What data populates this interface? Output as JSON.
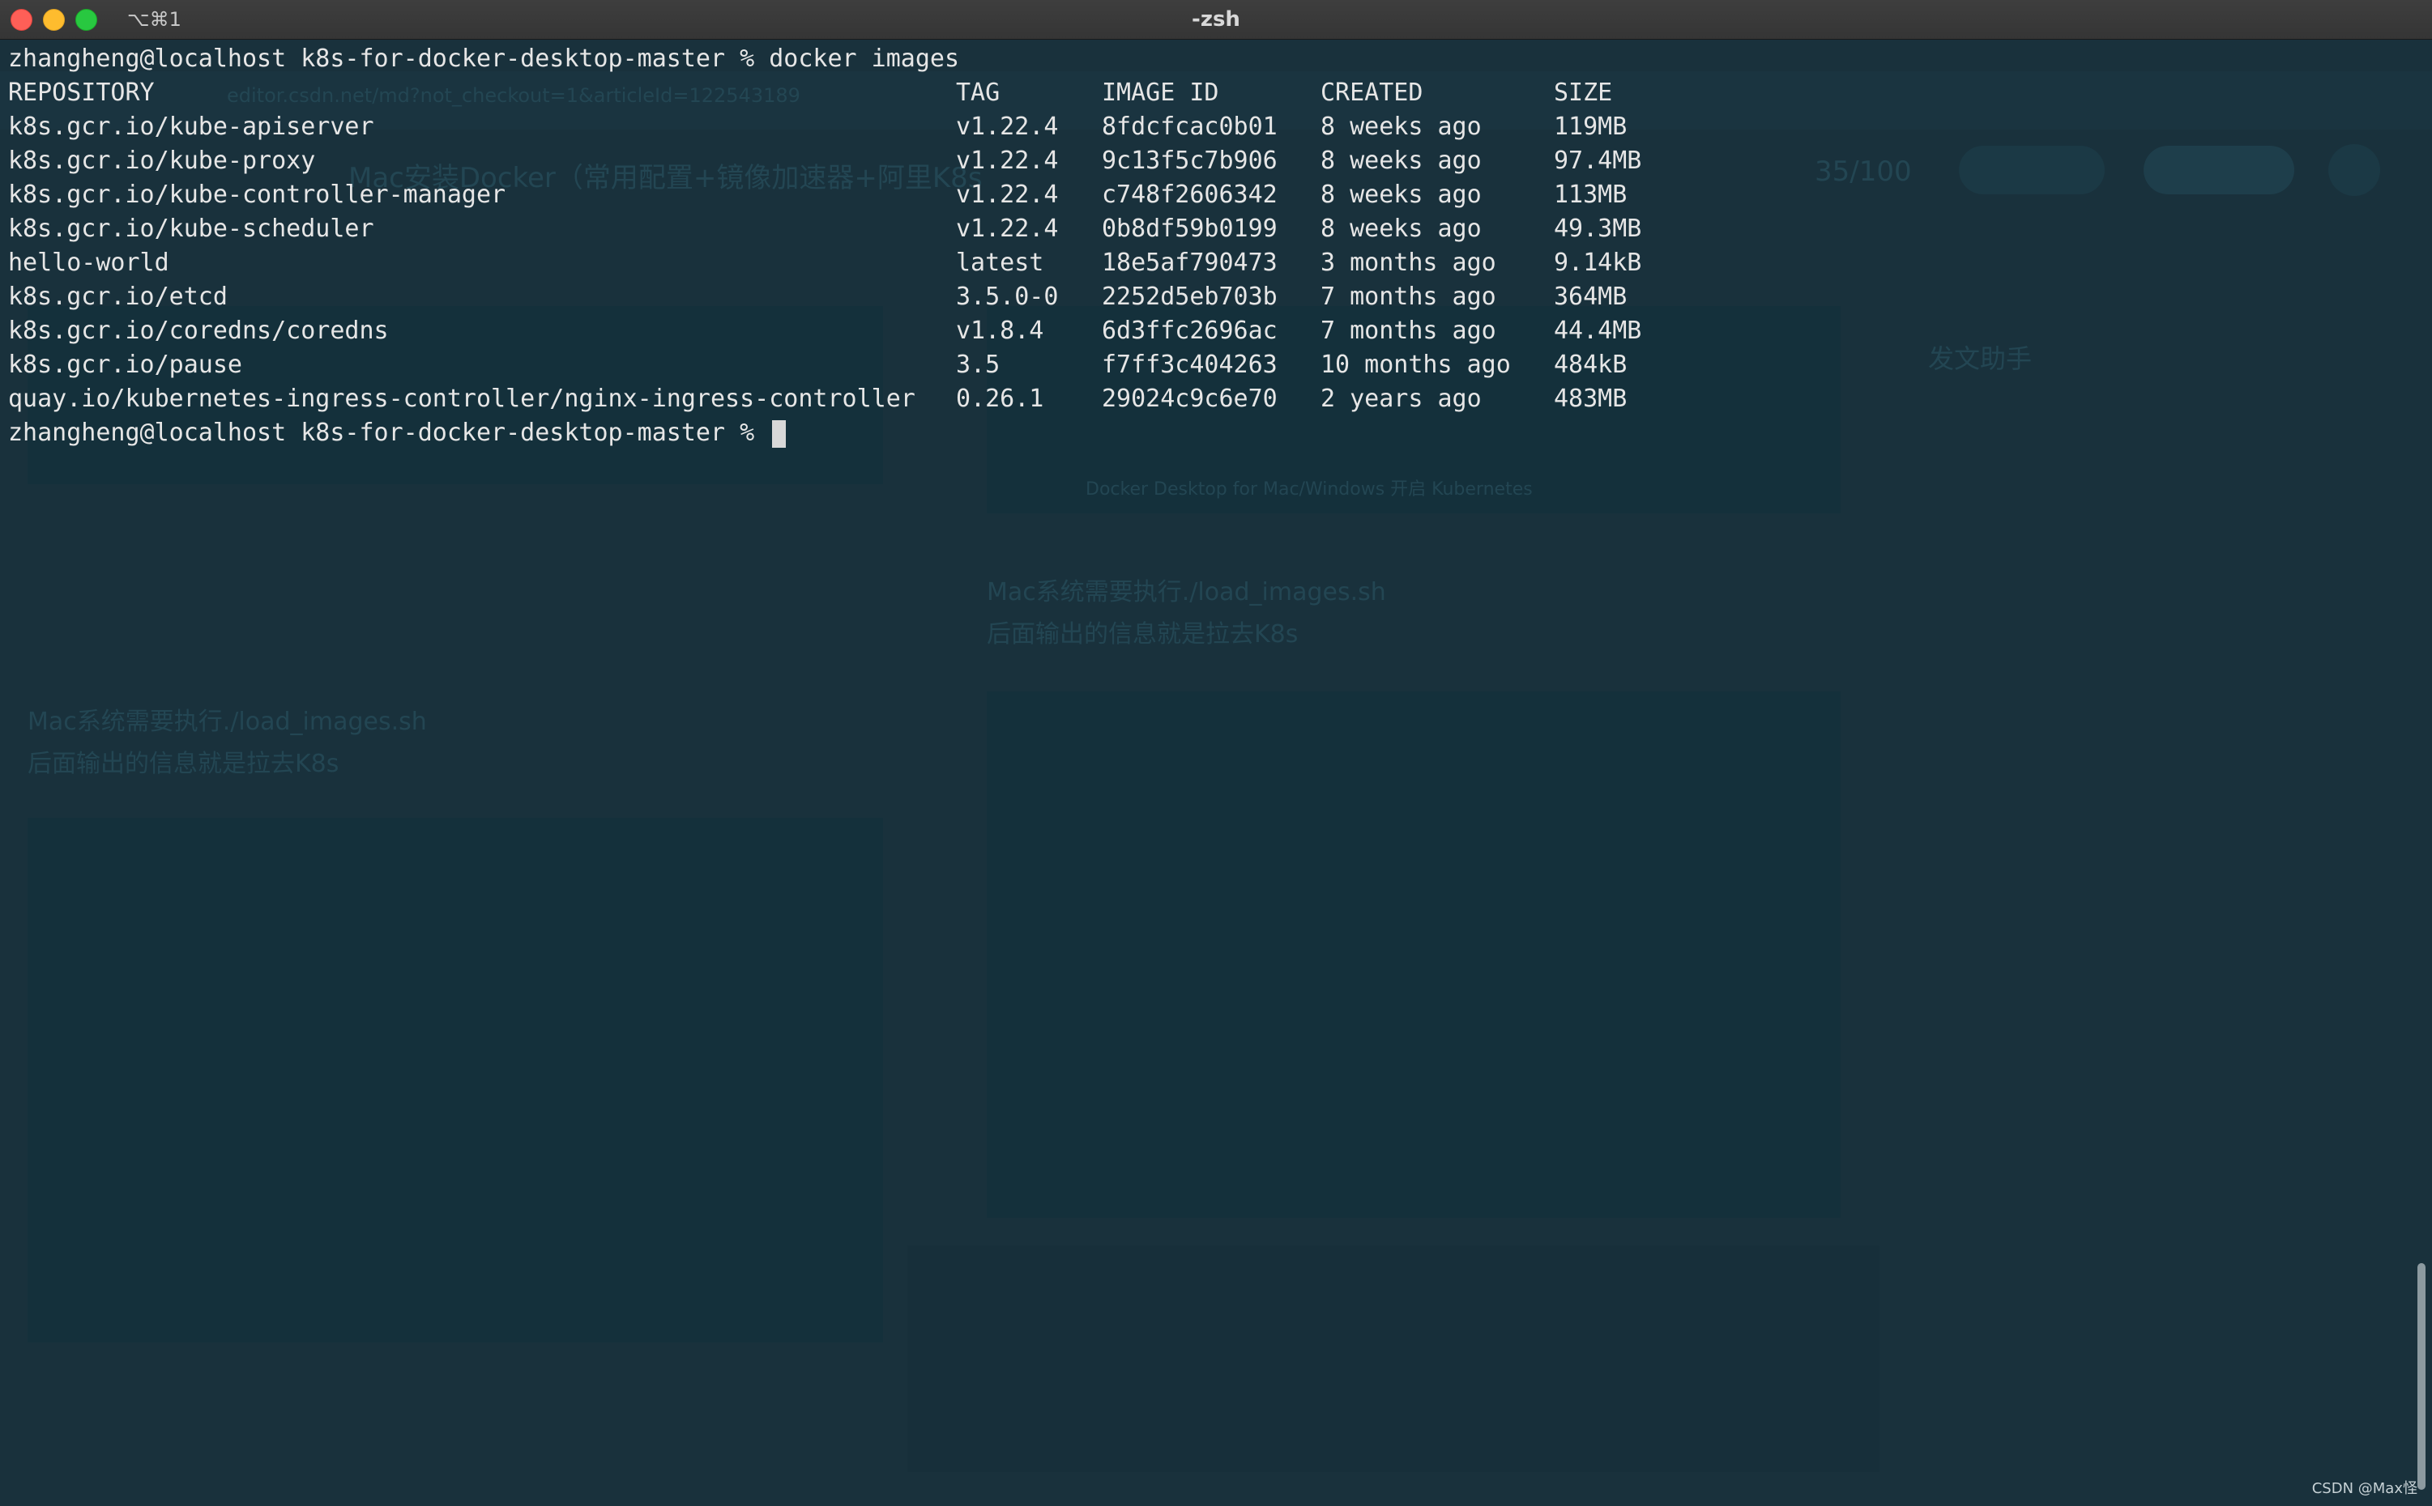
{
  "window": {
    "title": "-zsh",
    "tab_shortcut": "⌥⌘1"
  },
  "terminal": {
    "prompt_user_host": "zhangheng@localhost",
    "cwd": "k8s-for-docker-desktop-master",
    "command": "docker images",
    "headers": {
      "repository": "REPOSITORY",
      "tag": "TAG",
      "image_id": "IMAGE ID",
      "created": "CREATED",
      "size": "SIZE"
    },
    "rows": [
      {
        "repository": "k8s.gcr.io/kube-apiserver",
        "tag": "v1.22.4",
        "image_id": "8fdcfcac0b01",
        "created": "8 weeks ago",
        "size": "119MB"
      },
      {
        "repository": "k8s.gcr.io/kube-proxy",
        "tag": "v1.22.4",
        "image_id": "9c13f5c7b906",
        "created": "8 weeks ago",
        "size": "97.4MB"
      },
      {
        "repository": "k8s.gcr.io/kube-controller-manager",
        "tag": "v1.22.4",
        "image_id": "c748f2606342",
        "created": "8 weeks ago",
        "size": "113MB"
      },
      {
        "repository": "k8s.gcr.io/kube-scheduler",
        "tag": "v1.22.4",
        "image_id": "0b8df59b0199",
        "created": "8 weeks ago",
        "size": "49.3MB"
      },
      {
        "repository": "hello-world",
        "tag": "latest",
        "image_id": "18e5af790473",
        "created": "3 months ago",
        "size": "9.14kB"
      },
      {
        "repository": "k8s.gcr.io/etcd",
        "tag": "3.5.0-0",
        "image_id": "2252d5eb703b",
        "created": "7 months ago",
        "size": "364MB"
      },
      {
        "repository": "k8s.gcr.io/coredns/coredns",
        "tag": "v1.8.4",
        "image_id": "6d3ffc2696ac",
        "created": "7 months ago",
        "size": "44.4MB"
      },
      {
        "repository": "k8s.gcr.io/pause",
        "tag": "3.5",
        "image_id": "f7ff3c404263",
        "created": "10 months ago",
        "size": "484kB"
      },
      {
        "repository": "quay.io/kubernetes-ingress-controller/nginx-ingress-controller",
        "tag": "0.26.1",
        "image_id": "29024c9c6e70",
        "created": "2 years ago",
        "size": "483MB"
      }
    ]
  },
  "background_page": {
    "url": "editor.csdn.net/md?not_checkout=1&articleId=122543189",
    "title_fragment": "Mac安装Docker（常用配置+镜像加速器+阿里K8s",
    "word_count": "35/100",
    "assistant_title": "发文助手",
    "mac_note_line1": "Mac系统需要执行./load_images.sh",
    "mac_note_line2": "后面输出的信息就是拉去K8s",
    "image_caption": "Docker Desktop for Mac/Windows 开启 Kubernetes"
  },
  "watermark": "CSDN @Max怪",
  "colors": {
    "terminal_bg": "#19313c",
    "text": "#e6e6e6",
    "titlebar": "#3a3a3a"
  }
}
